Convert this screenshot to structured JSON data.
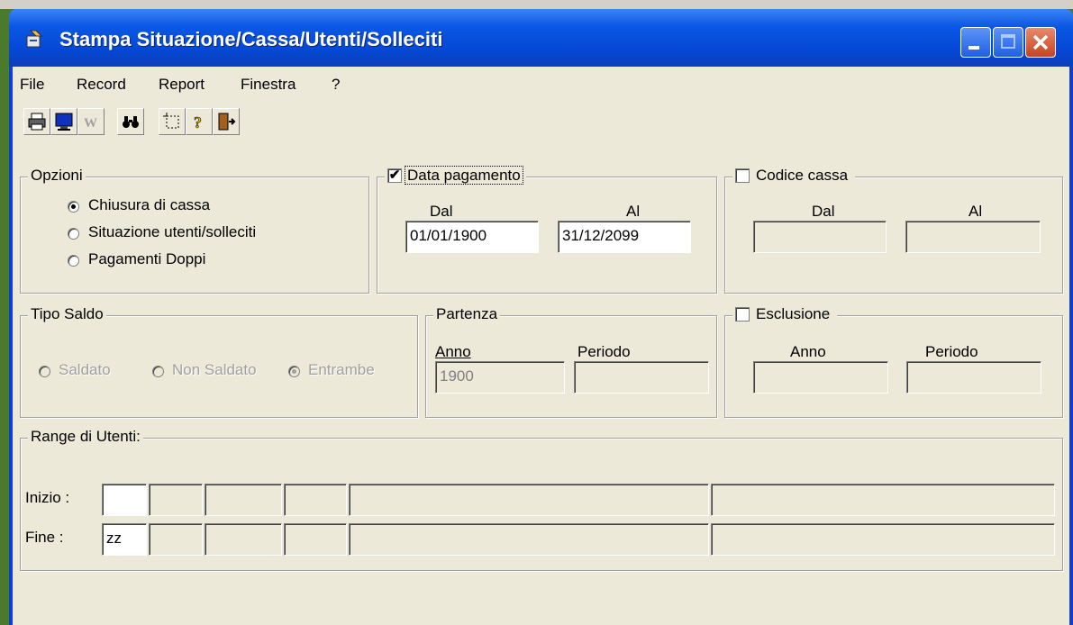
{
  "window": {
    "title": "Stampa Situazione/Cassa/Utenti/Solleciti"
  },
  "menu": [
    "File",
    "Record",
    "Report",
    "Finestra",
    "?"
  ],
  "toolbar": [
    "printer-icon",
    "monitor-icon",
    "word-icon",
    "binoculars-icon",
    "select-area-icon",
    "help-icon",
    "exit-door-icon"
  ],
  "opzioni": {
    "title": "Opzioni",
    "options": [
      "Chiusura di cassa",
      "Situazione utenti/solleciti",
      "Pagamenti Doppi"
    ],
    "selected": 0
  },
  "data_pagamento": {
    "title": "Data pagamento",
    "checked": true,
    "dal_label": "Dal",
    "al_label": "Al",
    "dal_value": "01/01/1900",
    "al_value": "31/12/2099"
  },
  "codice_cassa": {
    "title": "Codice cassa",
    "checked": false,
    "dal_label": "Dal",
    "al_label": "Al",
    "dal_value": "",
    "al_value": ""
  },
  "tipo_saldo": {
    "title": "Tipo Saldo",
    "options": [
      "Saldato",
      "Non Saldato",
      "Entrambe"
    ],
    "selected": 2
  },
  "partenza": {
    "title": "Partenza",
    "anno_label": "Anno",
    "periodo_label": "Periodo",
    "anno_value": "1900",
    "periodo_value": ""
  },
  "esclusione": {
    "title": "Esclusione",
    "checked": false,
    "anno_label": "Anno",
    "periodo_label": "Periodo",
    "anno_value": "",
    "periodo_value": ""
  },
  "range": {
    "title": "Range di Utenti:",
    "inizio_label": "Inizio :",
    "fine_label": "Fine :",
    "inizio_values": [
      "",
      "",
      "",
      "",
      "",
      ""
    ],
    "fine_values": [
      "zz",
      "",
      "",
      "",
      "",
      ""
    ]
  }
}
